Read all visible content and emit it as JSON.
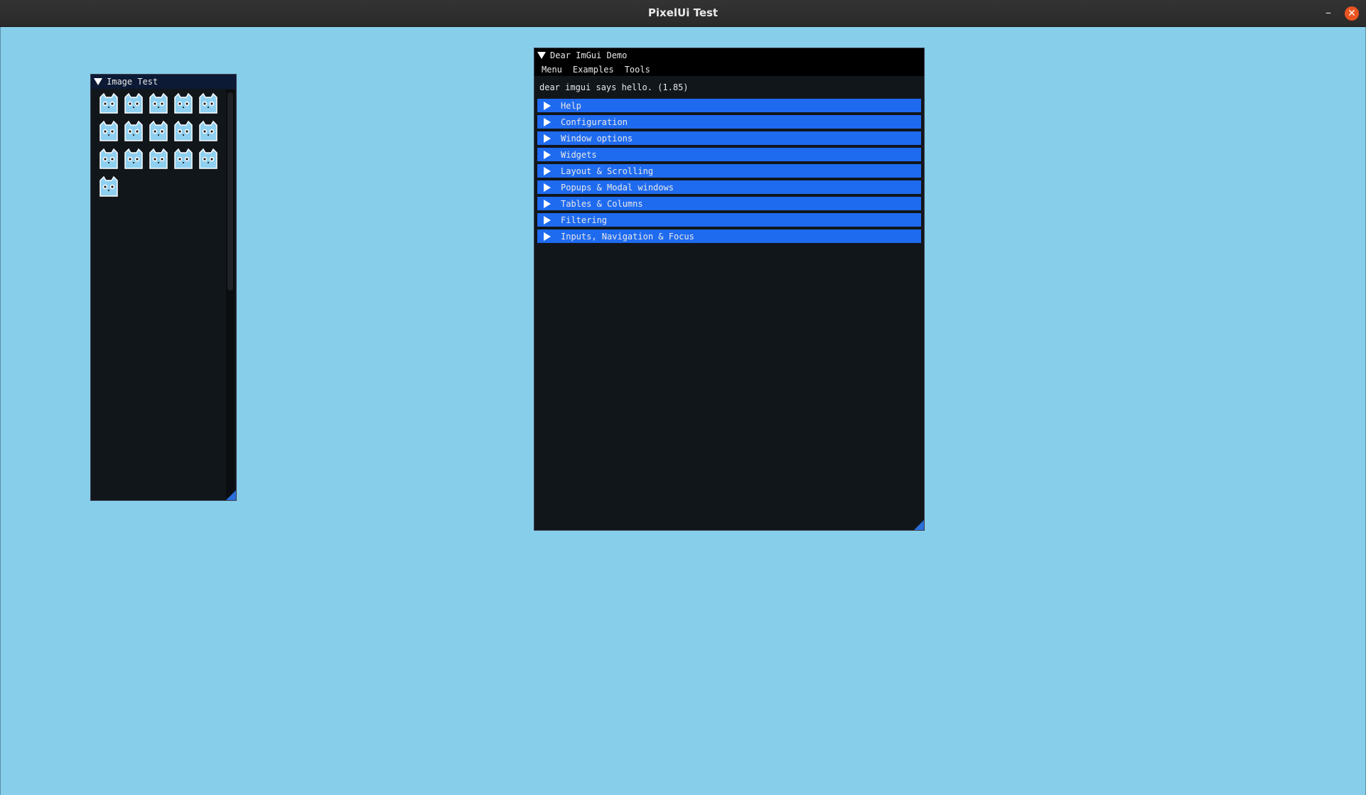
{
  "os_window": {
    "title": "PixelUi Test",
    "minimize_glyph": "–",
    "close_glyph": "✕",
    "close_color": "#e95420"
  },
  "image_test": {
    "title": "Image Test",
    "images": [
      {
        "name": "cat-icon"
      },
      {
        "name": "cat-sleepy-icon"
      },
      {
        "name": "cat-blush-icon"
      },
      {
        "name": "cat-sweat-icon"
      },
      {
        "name": "cat-cry-icon"
      },
      {
        "name": "cat-jar-icon"
      },
      {
        "name": "cat-glasses-icon"
      },
      {
        "name": "cat-dizzy-icon"
      },
      {
        "name": "cat-smug-icon"
      },
      {
        "name": "cat-wink-icon"
      },
      {
        "name": "cat-icon"
      },
      {
        "name": "cat-heart-eyes-icon"
      },
      {
        "name": "cat-star-icon"
      },
      {
        "name": "cat-icon"
      },
      {
        "name": "cat-bow-icon"
      },
      {
        "name": "cat-icon"
      }
    ]
  },
  "demo": {
    "title": "Dear ImGui Demo",
    "menu": [
      "Menu",
      "Examples",
      "Tools"
    ],
    "hello": "dear imgui says hello. (1.85)",
    "headers": [
      "Help",
      "Configuration",
      "Window options",
      "Widgets",
      "Layout & Scrolling",
      "Popups & Modal windows",
      "Tables & Columns",
      "Filtering",
      "Inputs, Navigation & Focus"
    ]
  },
  "colors": {
    "background": "#87ceea",
    "header": "#1f6bf0",
    "window_bg": "#11161b",
    "cat_body": "#8fd0f0"
  }
}
